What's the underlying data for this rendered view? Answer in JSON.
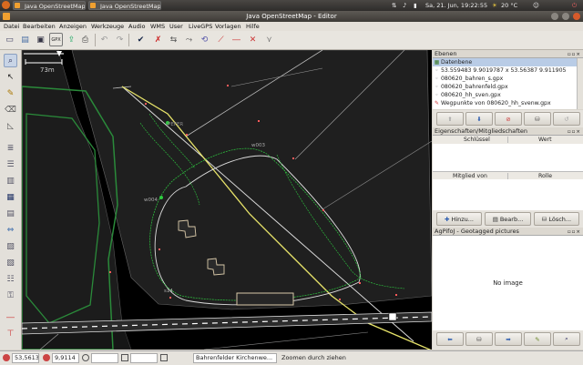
{
  "top_panel": {
    "tasks": [
      {
        "label": "Java OpenStreetMap ..."
      },
      {
        "label": "Java OpenStreetMap ..."
      }
    ],
    "clock": "Sa, 21. Jun, 19:22:55",
    "temperature": "20 °C"
  },
  "window": {
    "title": "Java OpenStreetMap - Editor"
  },
  "menu": [
    "Datei",
    "Bearbeiten",
    "Anzeigen",
    "Werkzeuge",
    "Audio",
    "WMS",
    "User",
    "LiveGPS",
    "Vorlagen",
    "Hilfe"
  ],
  "toolbar_icons": [
    "new-file-icon",
    "open-icon",
    "save-icon",
    "upload-gpx-icon",
    "upload-icon",
    "print-icon",
    "undo-icon",
    "redo-icon",
    "validate-icon",
    "split-icon",
    "reverse-icon",
    "align-circle-icon",
    "combine-icon",
    "line-icon",
    "crosshair-icon"
  ],
  "left_tools": [
    "zoom-icon",
    "select-icon",
    "draw-icon",
    "delete-icon",
    "extrude-icon",
    "layers-icon",
    "preferences-icon",
    "properties-icon",
    "relations-icon",
    "history-icon",
    "gps-icon",
    "conflict-icon",
    "commands-icon",
    "selection-list-icon",
    "keys-icon",
    "draw-tool-icon",
    "audio-icon",
    "geotag-icon"
  ],
  "map": {
    "scale_label": "73m",
    "labels": [
      {
        "text": "PEFER"
      },
      {
        "text": "w003"
      },
      {
        "text": "w004"
      },
      {
        "text": "s14"
      }
    ]
  },
  "layers_panel": {
    "title": "Ebenen",
    "items": [
      {
        "name": "Datenbene",
        "icon": "data-layer-icon",
        "active": true
      },
      {
        "name": "53.559483 9.9019787 x 53.56387 9.911905",
        "icon": "gpx-layer-icon"
      },
      {
        "name": "080620_bahren_s.gpx",
        "icon": "gpx-layer-icon"
      },
      {
        "name": "080620_bahrenfeld.gpx",
        "icon": "gpx-layer-icon"
      },
      {
        "name": "080620_hh_sven.gpx",
        "icon": "gpx-layer-icon"
      },
      {
        "name": "Wegpunkte von 080620_hh_svenw.gpx",
        "icon": "waypoint-layer-icon"
      }
    ],
    "buttons": [
      "move-up-icon",
      "move-down-icon",
      "toggle-visible-icon",
      "delete-layer-icon"
    ]
  },
  "properties_panel": {
    "title": "Eigenschaften/Mitgliedschaften",
    "col_key": "Schlüssel",
    "col_value": "Wert",
    "col_member": "Mitglied von",
    "col_role": "Rolle",
    "buttons": [
      {
        "label": "Hinzu..."
      },
      {
        "label": "Bearb..."
      },
      {
        "label": "Lösch..."
      }
    ]
  },
  "geotag_panel": {
    "title": "AgPifoJ - Geotagged pictures",
    "placeholder": "No image",
    "buttons": [
      "previous-icon",
      "center-icon",
      "next-icon",
      "edit-icon",
      "zoom-icon"
    ]
  },
  "status_bar": {
    "lat": "53,5613",
    "lon": "9,9114",
    "heading": "",
    "distance": "",
    "way_name": "Bahrenfelder Kirchenwe...",
    "hint": "Zoomen durch ziehen"
  },
  "colors": {
    "map_bg": "#000000",
    "area_fill": "#1e1e1e",
    "track": "#dcdcdc",
    "highlight_way": "#e8e46a",
    "node_red": "#ff5a5a",
    "gps_green": "#2ecc40"
  }
}
